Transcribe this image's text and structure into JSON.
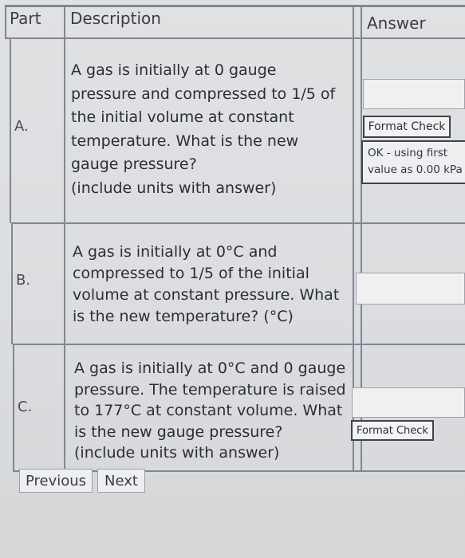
{
  "table": {
    "headers": {
      "part": "Part",
      "description": "Description",
      "answer": "Answer"
    },
    "rows": [
      {
        "part": "A.",
        "question": "A gas is initially at 0 gauge\npressure and compressed to 1/5 of\nthe initial volume at constant\ntemperature. What is the new\ngauge pressure?\n(include units with answer)",
        "answer_value": "",
        "format_check_label": "Format Check",
        "status": "OK - using first\nvalue as 0.00 kPa"
      },
      {
        "part": "B.",
        "question": "A gas is initially at 0°C and\ncompressed to 1/5 of the initial\nvolume at constant pressure. What\nis the new temperature? (°C)",
        "answer_value": ""
      },
      {
        "part": "C.",
        "question": "A gas is initially at 0°C and 0 gauge\npressure. The temperature is raised\nto 177°C at constant volume. What\nis the new gauge pressure?\n(include units with answer)",
        "answer_value": "",
        "format_check_label": "Format Check"
      }
    ]
  },
  "nav": {
    "previous_label": "Previous",
    "next_label": "Next"
  }
}
